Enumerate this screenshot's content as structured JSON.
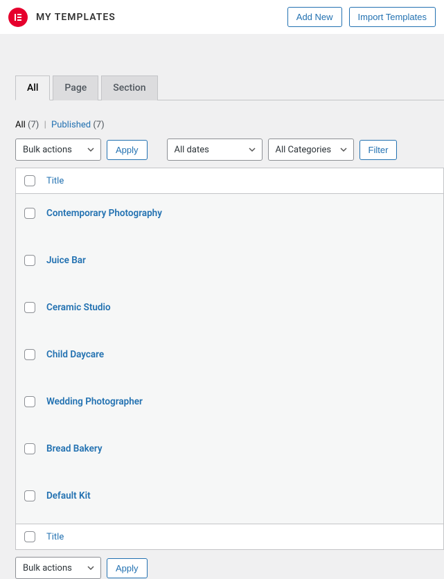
{
  "header": {
    "title": "My Templates",
    "add_new": "Add New",
    "import": "Import Templates"
  },
  "tabs": [
    {
      "label": "All",
      "active": true
    },
    {
      "label": "Page",
      "active": false
    },
    {
      "label": "Section",
      "active": false
    }
  ],
  "subsub": {
    "all_label": "All",
    "all_count": "(7)",
    "published_label": "Published",
    "published_count": "(7)"
  },
  "controls": {
    "bulk": "Bulk actions",
    "apply": "Apply",
    "dates": "All dates",
    "categories": "All Categories",
    "filter": "Filter"
  },
  "table": {
    "title_header": "Title",
    "rows": [
      {
        "title": "Contemporary Photography"
      },
      {
        "title": "Juice Bar"
      },
      {
        "title": "Ceramic Studio"
      },
      {
        "title": "Child Daycare"
      },
      {
        "title": "Wedding Photographer"
      },
      {
        "title": "Bread Bakery"
      },
      {
        "title": "Default Kit"
      }
    ]
  }
}
